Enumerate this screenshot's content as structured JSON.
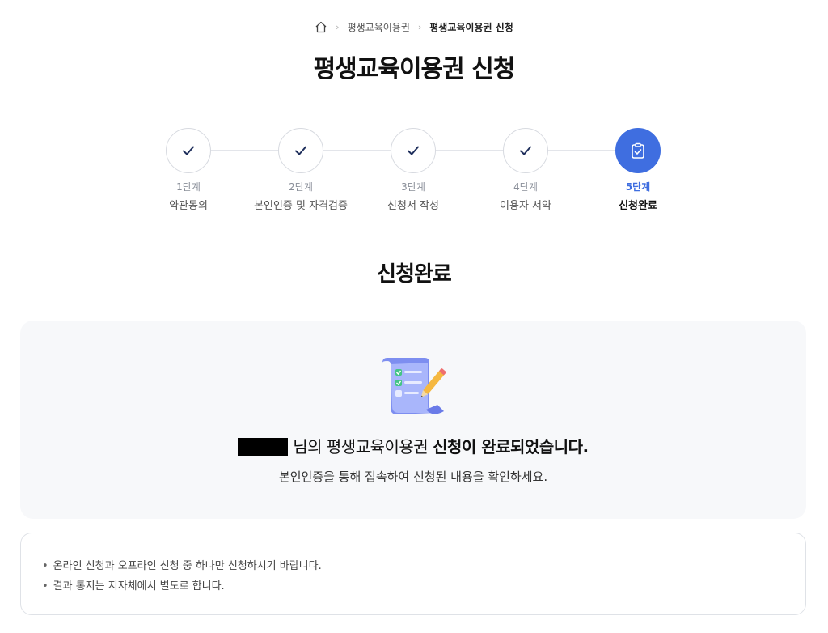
{
  "breadcrumb": {
    "items": [
      "평생교육이용권",
      "평생교육이용권 신청"
    ]
  },
  "page": {
    "title": "평생교육이용권 신청"
  },
  "steps": [
    {
      "num": "1단계",
      "label": "약관동의",
      "state": "done"
    },
    {
      "num": "2단계",
      "label": "본인인증 및 자격검증",
      "state": "done"
    },
    {
      "num": "3단계",
      "label": "신청서 작성",
      "state": "done"
    },
    {
      "num": "4단계",
      "label": "이용자 서약",
      "state": "done"
    },
    {
      "num": "5단계",
      "label": "신청완료",
      "state": "active"
    }
  ],
  "section": {
    "title": "신청완료"
  },
  "result": {
    "message_mid": " 님의 평생교육이용권 ",
    "message_strong": "신청이 완료되었습니다.",
    "sub": "본인인증을 통해 접속하여 신청된 내용을 확인하세요."
  },
  "notice": {
    "items": [
      "온라인 신청과 오프라인 신청 중 하나만 신청하시기 바랍니다.",
      "결과 통지는 지자체에서 별도로 합니다."
    ]
  },
  "colors": {
    "accent": "#3f6ee0",
    "check": "#1f2f5c",
    "panel_bg": "#f7f8fa"
  },
  "icons": {
    "home": "home-icon",
    "done": "check-icon",
    "active": "clipboard-check-icon",
    "illustration": "document-pencil-icon"
  }
}
